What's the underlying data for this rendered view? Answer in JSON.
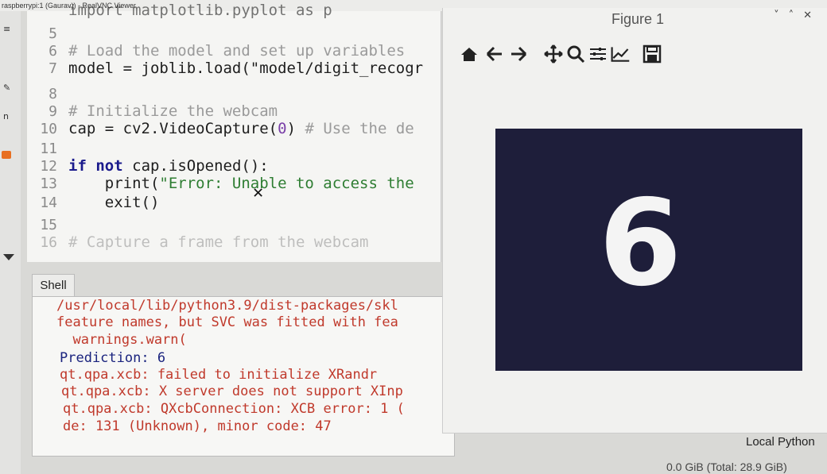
{
  "window": {
    "title": "raspberrypi:1 (Gaurav)) - RealVNC Viewer"
  },
  "editor": {
    "top_line_partial": "import matplotlib.pyplot as p",
    "lines": [
      {
        "num": "5",
        "text": ""
      },
      {
        "num": "6",
        "text": "# Load the model and set up variables"
      },
      {
        "num": "7",
        "text": "model = joblib.load(\"model/digit_recogr"
      },
      {
        "num": "8",
        "text": ""
      },
      {
        "num": "9",
        "text": "# Initialize the webcam"
      },
      {
        "num": "10",
        "text_code": "cap = cv2.VideoCapture(",
        "text_arg": "0",
        "text_close": ")",
        "text_comment": "  # Use the de"
      },
      {
        "num": "11",
        "text": ""
      },
      {
        "num": "12",
        "text_kw1": "if",
        "text_kw2": "not",
        "text_rest": "cap.isOpened():"
      },
      {
        "num": "13",
        "text_code": "    print(",
        "text_str": "\"Error: Unable to access the"
      },
      {
        "num": "14",
        "text": "    exit()"
      },
      {
        "num": "15",
        "text": ""
      },
      {
        "num": "16",
        "text": "# Capture a frame from the webcam"
      }
    ]
  },
  "shell": {
    "tab_label": "Shell",
    "lines": [
      {
        "kind": "err",
        "text": "/usr/local/lib/python3.9/dist-packages/skl"
      },
      {
        "kind": "err",
        "text": "feature names, but SVC was fitted with fea"
      },
      {
        "kind": "err",
        "text": "  warnings.warn("
      },
      {
        "kind": "out",
        "text": "Prediction: 6"
      },
      {
        "kind": "err",
        "text": "qt.qpa.xcb: failed to initialize XRandr"
      },
      {
        "kind": "err",
        "text": "qt.qpa.xcb: X server does not support XInp"
      },
      {
        "kind": "err",
        "text": "qt.qpa.xcb: QXcbConnection: XCB error: 1 ("
      },
      {
        "kind": "err",
        "text": "de: 131 (Unknown), minor code: 47"
      }
    ]
  },
  "status": {
    "interpreter": "Local Python",
    "memory": "0.0 GiB (Total: 28.9 GiB)"
  },
  "figure": {
    "title": "Figure 1",
    "toolbar_icons": [
      "home-icon",
      "back-arrow-icon",
      "forward-arrow-icon",
      "pan-icon",
      "zoom-icon",
      "subplots-icon",
      "edit-axes-icon",
      "save-icon"
    ],
    "digit": "6",
    "canvas_color": "#1e1e3a"
  }
}
